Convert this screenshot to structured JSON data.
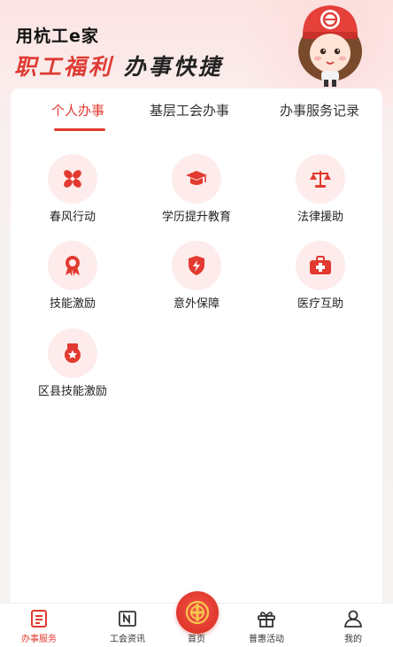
{
  "header": {
    "app_title": "用杭工e家",
    "slogan_accent": "职工福利",
    "slogan_rest": "办事快捷"
  },
  "tabs": [
    {
      "label": "个人办事",
      "active": true
    },
    {
      "label": "基层工会办事",
      "active": false
    },
    {
      "label": "办事服务记录",
      "active": false
    }
  ],
  "services": [
    {
      "label": "春风行动",
      "icon": "fan-icon"
    },
    {
      "label": "学历提升教育",
      "icon": "graduation-cap-icon"
    },
    {
      "label": "法律援助",
      "icon": "scales-icon"
    },
    {
      "label": "技能激励",
      "icon": "award-ribbon-icon"
    },
    {
      "label": "意外保障",
      "icon": "shield-lightning-icon"
    },
    {
      "label": "医疗互助",
      "icon": "medical-kit-icon"
    },
    {
      "label": "区县技能激励",
      "icon": "medal-star-icon"
    }
  ],
  "bottom_nav": [
    {
      "label": "办事服务",
      "icon": "document-list-icon",
      "active": true
    },
    {
      "label": "工会资讯",
      "icon": "news-icon",
      "active": false
    },
    {
      "label": "首页",
      "icon": "union-emblem-icon",
      "active": false
    },
    {
      "label": "普惠活动",
      "icon": "gift-icon",
      "active": false
    },
    {
      "label": "我的",
      "icon": "user-icon",
      "active": false
    }
  ],
  "colors": {
    "accent": "#e23a30",
    "icon_bg": "#fdeceb"
  }
}
